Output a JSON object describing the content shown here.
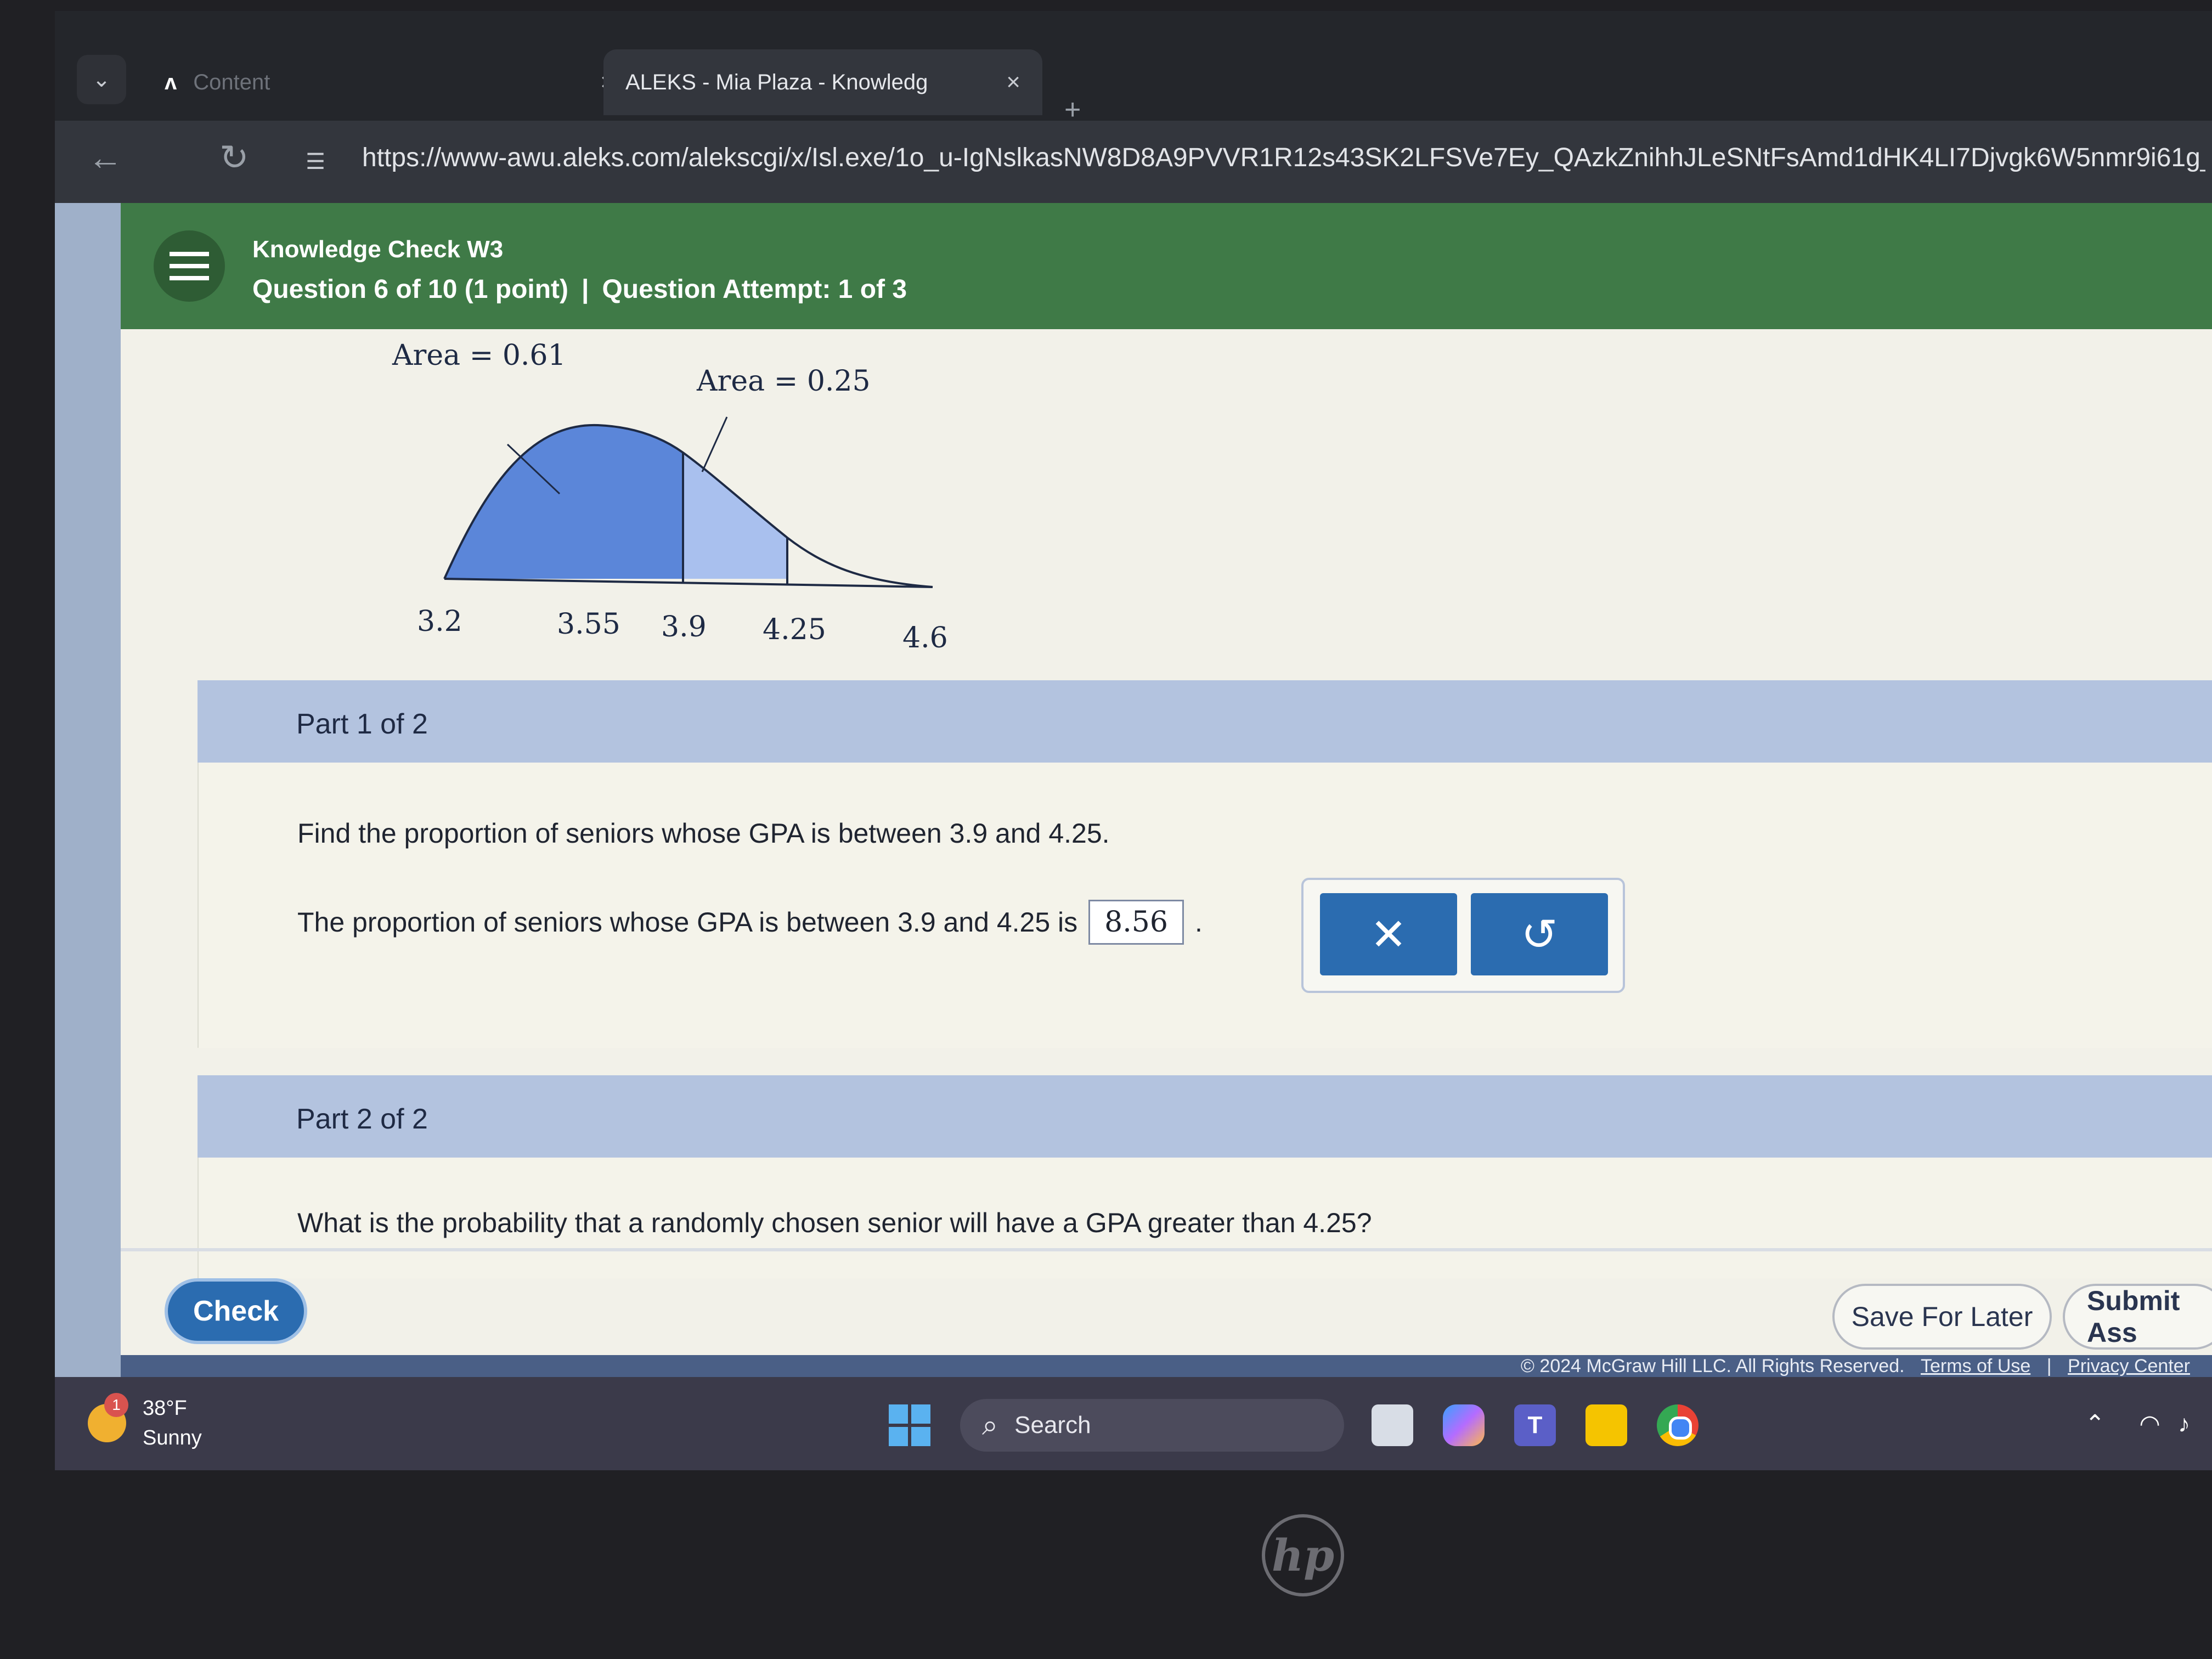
{
  "browser": {
    "tabs": [
      {
        "label": "Content",
        "close": "×"
      },
      {
        "label": "ALEKS - Mia Plaza - Knowledg",
        "close": "×"
      }
    ],
    "new_tab": "+",
    "url": "https://www-awu.aleks.com/alekscgi/x/Isl.exe/1o_u-IgNslkasNW8D8A9PVVR1R12s43SK2LFSVe7Ey_QAzkZnihhJLeSNtFsAmd1dHK4LI7Djvgk6W5nmr9i61g_6z6n6wmjTQ"
  },
  "header": {
    "title": "Knowledge Check W3",
    "question": "Question 6 of 10 (1 point)",
    "separator": "|",
    "attempt": "Question Attempt: 1 of 3"
  },
  "graph": {
    "area_left_label": "Area = 0.61",
    "area_right_label": "Area = 0.25",
    "ticks": [
      "3.2",
      "3.55",
      "3.9",
      "4.25",
      "4.6"
    ],
    "colors": {
      "dark_fill": "#5b86d9",
      "light_fill": "#a9c0ee",
      "outline": "#1e2a44"
    }
  },
  "part1": {
    "label": "Part 1 of 2",
    "question": "Find the proportion of seniors whose GPA is between 3.9 and 4.25.",
    "answer_prefix": "The proportion of seniors whose GPA is between 3.9 and 4.25 is",
    "answer_value": "8.56",
    "answer_suffix": ".",
    "clear_symbol": "✕",
    "undo_symbol": "↺"
  },
  "part2": {
    "label": "Part 2 of 2",
    "question": "What is the probability that a randomly chosen senior will have a GPA greater than 4.25?"
  },
  "footer": {
    "check": "Check",
    "save_later": "Save For Later",
    "submit": "Submit Ass",
    "copyright": "© 2024 McGraw Hill LLC. All Rights Reserved.",
    "terms": "Terms of Use",
    "privacy": "Privacy Center",
    "link_sep": "|"
  },
  "taskbar": {
    "temperature": "38°F",
    "condition": "Sunny",
    "weather_badge": "1",
    "search": "Search",
    "teams_letter": "T"
  },
  "colors": {
    "accent": "#2b6cb0",
    "header_green": "#3f7a47",
    "part_bar": "#b3c3df"
  }
}
